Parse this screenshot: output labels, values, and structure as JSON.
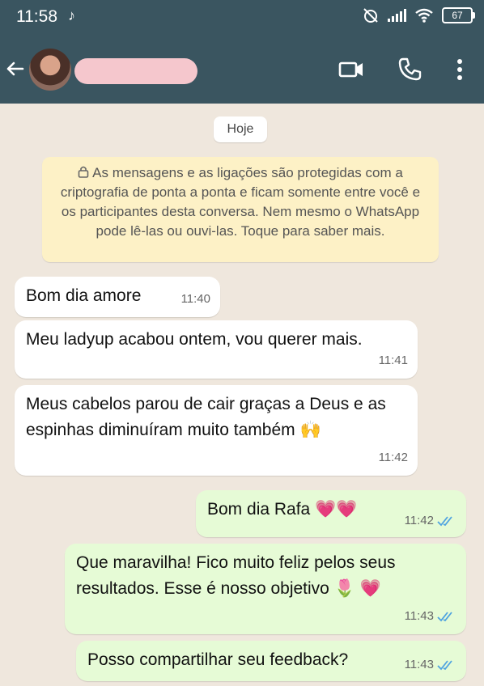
{
  "status": {
    "time": "11:58",
    "tiktok_glyph": "♪",
    "battery": "67",
    "icons": [
      "tiktok-icon",
      "muted-alarm-icon",
      "signal-icon",
      "wifi-icon",
      "battery-icon"
    ]
  },
  "header": {
    "back_icon": "back-arrow-icon",
    "video_icon": "video-call-icon",
    "call_icon": "phone-icon",
    "menu_icon": "more-vertical-icon"
  },
  "chat": {
    "day_label": "Hoje",
    "encryption_notice": "As mensagens e as ligações são protegidas com a criptografia de ponta a ponta e ficam somente entre você e os participantes desta conversa. Nem mesmo o WhatsApp pode lê-las ou ouvi-las. Toque para saber mais.",
    "messages": [
      {
        "direction": "in",
        "text": "Bom dia amore",
        "time": "11:40"
      },
      {
        "direction": "in",
        "text": "Meu ladyup acabou ontem, vou querer mais.",
        "time": "11:41"
      },
      {
        "direction": "in",
        "text": "Meus cabelos parou de cair graças a Deus e as espinhas diminuíram muito também 🙌",
        "time": "11:42"
      },
      {
        "direction": "out",
        "text": "Bom dia Rafa 💗💗",
        "time": "11:42",
        "status": "read"
      },
      {
        "direction": "out",
        "text": "Que maravilha! Fico muito feliz pelos seus resultados. Esse é nosso objetivo 🌷 💗",
        "time": "11:43",
        "status": "read"
      },
      {
        "direction": "out",
        "text": "Posso compartilhar seu feedback?",
        "time": "11:43",
        "status": "read"
      }
    ]
  },
  "colors": {
    "header_bg": "#3a5560",
    "chat_bg": "#efe7dd",
    "incoming_bubble": "#ffffff",
    "outgoing_bubble": "#e6fbd6",
    "read_tick": "#4fa3e0",
    "notice_bg": "#fdf1c6"
  }
}
